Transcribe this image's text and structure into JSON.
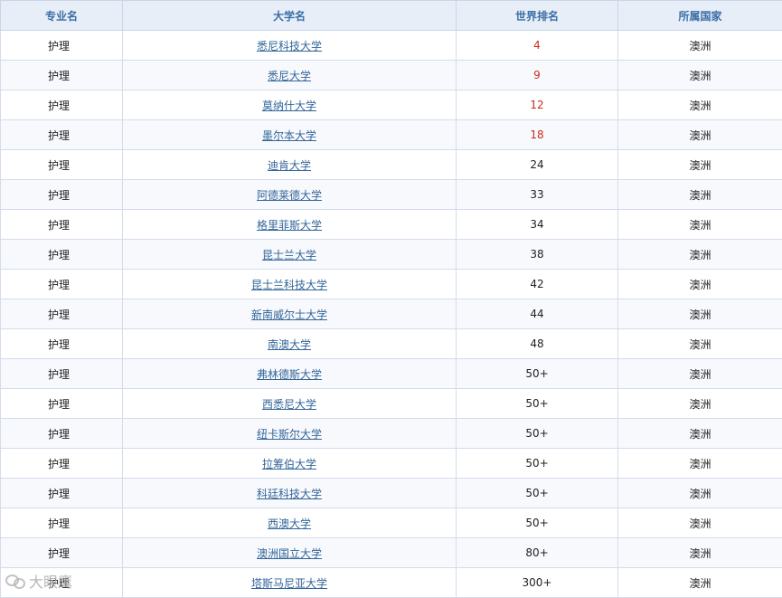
{
  "table": {
    "headers": [
      "专业名",
      "大学名",
      "世界排名",
      "所属国家"
    ],
    "rows": [
      {
        "major": "护理",
        "university": "悉尼科技大学",
        "rank": "4",
        "country": "澳洲",
        "highlight": true
      },
      {
        "major": "护理",
        "university": "悉尼大学",
        "rank": "9",
        "country": "澳洲",
        "highlight": true
      },
      {
        "major": "护理",
        "university": "莫纳什大学",
        "rank": "12",
        "country": "澳洲",
        "highlight": true
      },
      {
        "major": "护理",
        "university": "墨尔本大学",
        "rank": "18",
        "country": "澳洲",
        "highlight": true
      },
      {
        "major": "护理",
        "university": "迪肯大学",
        "rank": "24",
        "country": "澳洲",
        "highlight": false
      },
      {
        "major": "护理",
        "university": "阿德莱德大学",
        "rank": "33",
        "country": "澳洲",
        "highlight": false
      },
      {
        "major": "护理",
        "university": "格里菲斯大学",
        "rank": "34",
        "country": "澳洲",
        "highlight": false
      },
      {
        "major": "护理",
        "university": "昆士兰大学",
        "rank": "38",
        "country": "澳洲",
        "highlight": false
      },
      {
        "major": "护理",
        "university": "昆士兰科技大学",
        "rank": "42",
        "country": "澳洲",
        "highlight": false
      },
      {
        "major": "护理",
        "university": "新南威尔士大学",
        "rank": "44",
        "country": "澳洲",
        "highlight": false
      },
      {
        "major": "护理",
        "university": "南澳大学",
        "rank": "48",
        "country": "澳洲",
        "highlight": false
      },
      {
        "major": "护理",
        "university": "弗林德斯大学",
        "rank": "50+",
        "country": "澳洲",
        "highlight": false
      },
      {
        "major": "护理",
        "university": "西悉尼大学",
        "rank": "50+",
        "country": "澳洲",
        "highlight": false
      },
      {
        "major": "护理",
        "university": "纽卡斯尔大学",
        "rank": "50+",
        "country": "澳洲",
        "highlight": false
      },
      {
        "major": "护理",
        "university": "拉筹伯大学",
        "rank": "50+",
        "country": "澳洲",
        "highlight": false
      },
      {
        "major": "护理",
        "university": "科廷科技大学",
        "rank": "50+",
        "country": "澳洲",
        "highlight": false
      },
      {
        "major": "护理",
        "university": "西澳大学",
        "rank": "50+",
        "country": "澳洲",
        "highlight": false
      },
      {
        "major": "护理",
        "university": "澳洲国立大学",
        "rank": "80+",
        "country": "澳洲",
        "highlight": false
      },
      {
        "major": "护理",
        "university": "塔斯马尼亚大学",
        "rank": "300+",
        "country": "澳洲",
        "highlight": false
      }
    ]
  },
  "colors": {
    "header_text": "#3a6fa6",
    "link": "#336699",
    "top_rank": "#cc2a1e"
  },
  "watermark": {
    "text": "大眼鹰",
    "icon": "wechat-logo-icon"
  }
}
